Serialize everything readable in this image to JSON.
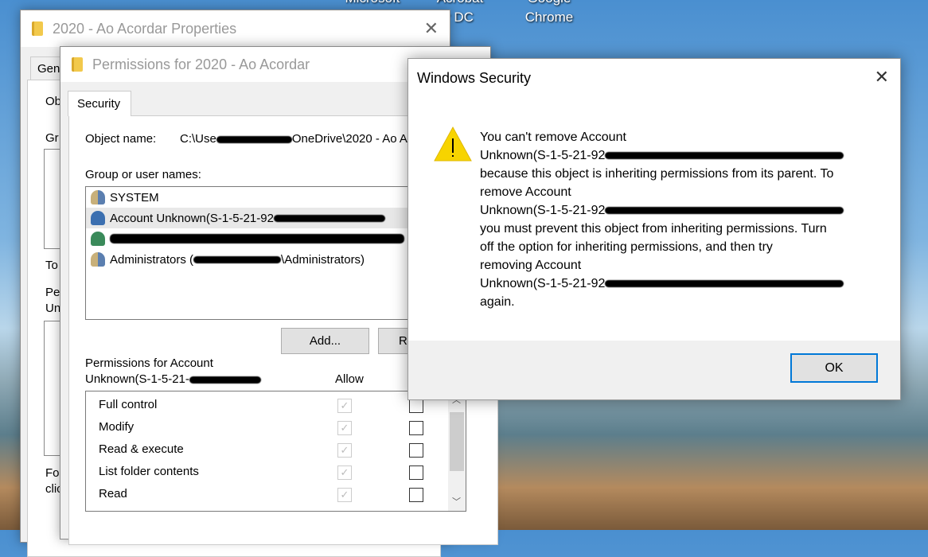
{
  "desktop": {
    "icons": [
      {
        "label": "Microsoft"
      },
      {
        "label": "Acrobat"
      },
      {
        "label": "der DC"
      },
      {
        "label": "Google"
      },
      {
        "label": "Chrome"
      }
    ]
  },
  "properties_window": {
    "title": "2020 - Ao Acordar Properties",
    "tab_partial": "Gen",
    "labels_partial": [
      "Ob",
      "Gr",
      "To",
      "Pe",
      "Un",
      "Fo",
      "clic"
    ]
  },
  "permissions_window": {
    "title": "Permissions for 2020 - Ao Acordar",
    "tab": "Security",
    "object_name_label": "Object name:",
    "object_name_prefix": "C:\\Use",
    "object_name_suffix": "OneDrive\\2020 - Ao A",
    "group_label": "Group or user names:",
    "users": [
      {
        "name": "SYSTEM",
        "icon": "users-icon"
      },
      {
        "name": "Account Unknown(S-1-5-21-92",
        "icon": "unknown-user-icon",
        "selected": true
      },
      {
        "name": "",
        "icon": "user-icon"
      },
      {
        "name": "Administrators (",
        "suffix": "\\Administrators)",
        "icon": "users-icon"
      }
    ],
    "add_button": "Add...",
    "remove_button_partial": "R",
    "permissions_for_line1": "Permissions for Account",
    "permissions_for_line2": "Unknown(S-1-5-21-",
    "allow_header": "Allow",
    "permissions": [
      {
        "name": "Full control",
        "allow": true,
        "deny": false
      },
      {
        "name": "Modify",
        "allow": true,
        "deny": false
      },
      {
        "name": "Read & execute",
        "allow": true,
        "deny": false
      },
      {
        "name": "List folder contents",
        "allow": true,
        "deny": false
      },
      {
        "name": "Read",
        "allow": true,
        "deny": false
      }
    ]
  },
  "security_dialog": {
    "title": "Windows Security",
    "lines": [
      "You can't remove Account",
      "Unknown(S-1-5-21-92",
      "because this object is inheriting permissions from its parent. To",
      "remove Account",
      "Unknown(S-1-5-21-92",
      "you must prevent this object from inheriting permissions.  Turn",
      "off the option for inheriting permissions, and then try",
      "removing Account",
      "Unknown(S-1-5-21-92",
      "again."
    ],
    "ok_button": "OK",
    "warning_color": "#f7d400",
    "accent": "#0078d7"
  }
}
